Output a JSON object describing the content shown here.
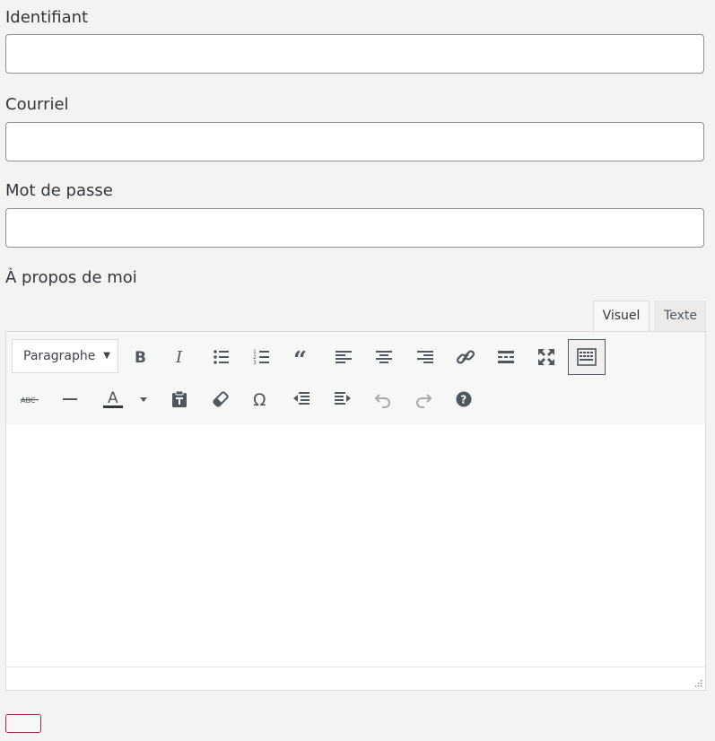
{
  "form": {
    "username_label": "Identifiant",
    "username_value": "",
    "email_label": "Courriel",
    "email_value": "",
    "password_label": "Mot de passe",
    "password_value": "",
    "about_label": "À propos de moi"
  },
  "editor": {
    "tab_visual": "Visuel",
    "tab_text": "Texte",
    "format_select": "Paragraphe",
    "content": "",
    "toolbar_row1": [
      "bold-icon",
      "italic-icon",
      "bulleted-list-icon",
      "numbered-list-icon",
      "blockquote-icon",
      "align-left-icon",
      "align-center-icon",
      "align-right-icon",
      "link-icon",
      "read-more-icon",
      "fullscreen-icon",
      "toolbar-toggle-icon"
    ],
    "toolbar_row2": [
      "strikethrough-icon",
      "horizontal-line-icon",
      "text-color-icon",
      "paste-as-text-icon",
      "clear-formatting-icon",
      "special-character-icon",
      "outdent-icon",
      "indent-icon",
      "undo-icon",
      "redo-icon",
      "help-icon"
    ],
    "colors": {
      "icon": "#50575e",
      "icon_disabled": "#a7aaad",
      "text_color_bar": "#32373c"
    }
  },
  "submit": {
    "label": ""
  },
  "colors": {
    "background": "#f3f3f3",
    "submit_border": "#b0224a"
  }
}
